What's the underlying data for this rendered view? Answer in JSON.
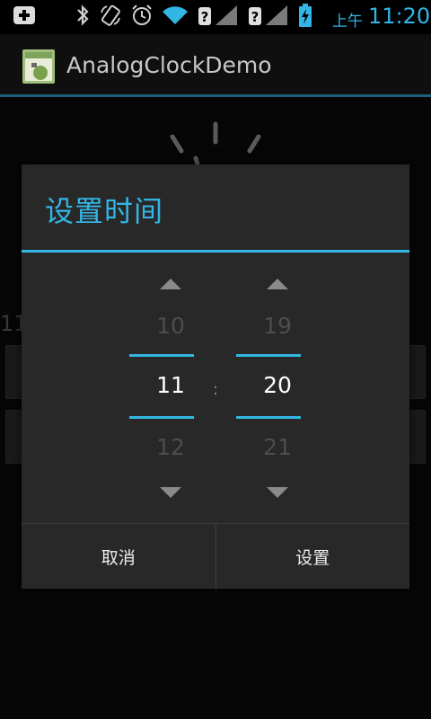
{
  "status_bar": {
    "ampm": "上午",
    "time": "11:20",
    "icons": [
      "add-notification-icon",
      "bluetooth-icon",
      "rotate-icon",
      "alarm-icon",
      "wifi-icon",
      "signal-unknown-icon",
      "signal-unknown-icon",
      "battery-charging-icon"
    ]
  },
  "action_bar": {
    "title": "AnalogClockDemo"
  },
  "background": {
    "partial_text": "11"
  },
  "dialog": {
    "title": "设置时间",
    "hour": {
      "prev": "10",
      "current": "11",
      "next": "12"
    },
    "separator": ":",
    "minute": {
      "prev": "19",
      "current": "20",
      "next": "21"
    },
    "buttons": {
      "cancel": "取消",
      "set": "设置"
    }
  },
  "colors": {
    "accent": "#33b5e5",
    "dialog_bg": "#282828",
    "dim_text": "#4d4d4d"
  }
}
